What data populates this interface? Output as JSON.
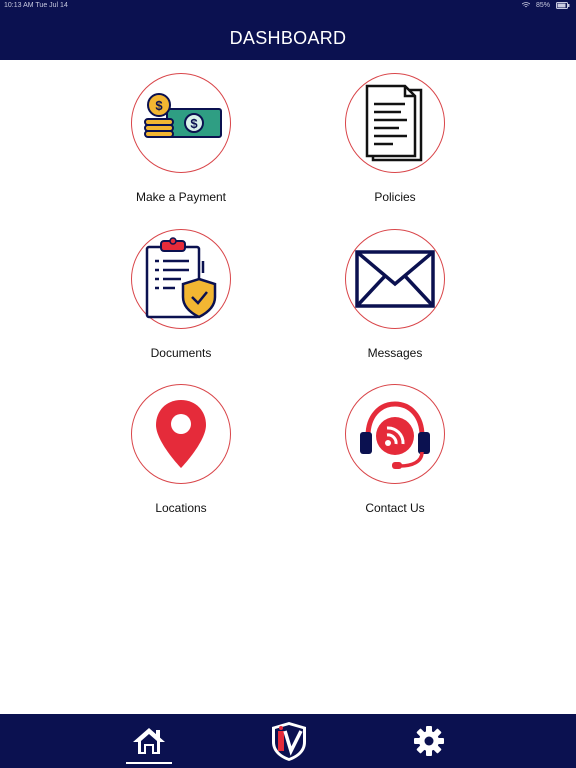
{
  "status_bar": {
    "time": "10:13 AM",
    "date": "Tue Jul 14",
    "battery": "85%"
  },
  "header": {
    "title": "DASHBOARD"
  },
  "tiles": [
    {
      "label": "Make a Payment",
      "icon": "payment-icon"
    },
    {
      "label": "Policies",
      "icon": "policy-document-icon"
    },
    {
      "label": "Documents",
      "icon": "clipboard-shield-icon"
    },
    {
      "label": "Messages",
      "icon": "envelope-icon"
    },
    {
      "label": "Locations",
      "icon": "location-pin-icon"
    },
    {
      "label": "Contact Us",
      "icon": "headset-icon"
    }
  ],
  "tabbar": {
    "items": [
      {
        "icon": "home-icon",
        "active": true
      },
      {
        "icon": "shield-logo-icon",
        "active": false
      },
      {
        "icon": "gear-icon",
        "active": false
      }
    ]
  },
  "colors": {
    "navy": "#0b1150",
    "accent_red": "#e52b3a",
    "ring": "#d9464a",
    "gold": "#f2b632",
    "green": "#2f9e83"
  }
}
